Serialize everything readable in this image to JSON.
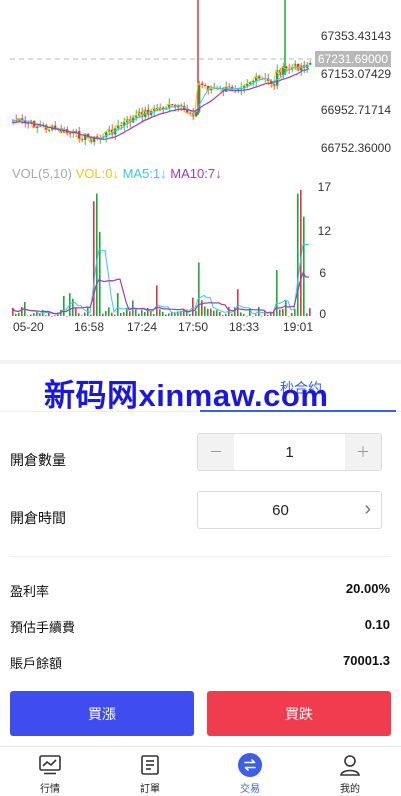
{
  "chart": {
    "price_labels": [
      "67353.43143",
      "67153.07429",
      "66952.71714",
      "66752.36000"
    ],
    "current_price": "67231.69000",
    "vol_legend": {
      "base": "VOL(5,10)",
      "vol": "VOL:0↓",
      "ma5": "MA5:1↓",
      "ma10": "MA10:7↓"
    },
    "vol_axis": [
      "17",
      "12",
      "6",
      "0"
    ],
    "time_labels": [
      "05-20",
      "16:58",
      "17:24",
      "17:50",
      "18:33",
      "19:01"
    ],
    "colors": {
      "up": "#1aa83a",
      "down": "#e8323f",
      "ma_yellow": "#f5c518",
      "ma_cyan": "#3ec6e6",
      "ma_purple": "#9b3fb5"
    }
  },
  "watermark": "新码网xinmaw.com",
  "tabs": [
    {
      "label": "",
      "active": false
    },
    {
      "label": "秒合约",
      "active": true
    }
  ],
  "form": {
    "quantity_label": "開倉數量",
    "quantity_value": "1",
    "minus": "－",
    "plus": "＋",
    "time_label": "開倉時間",
    "time_value": "60"
  },
  "info": {
    "profit_rate_label": "盈利率",
    "profit_rate_value": "20.00%",
    "fee_label": "預估手續費",
    "fee_value": "0.10",
    "balance_label": "賬戶餘額",
    "balance_value": "70001.3"
  },
  "actions": {
    "buy": "買漲",
    "sell": "買跌"
  },
  "nav": [
    {
      "label": "行情",
      "icon": "chart-icon",
      "active": false
    },
    {
      "label": "訂單",
      "icon": "document-icon",
      "active": false
    },
    {
      "label": "交易",
      "icon": "exchange-icon",
      "active": true
    },
    {
      "label": "我的",
      "icon": "user-icon",
      "active": false
    }
  ]
}
